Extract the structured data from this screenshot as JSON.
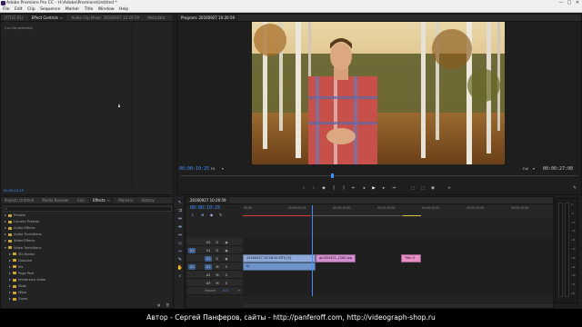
{
  "window": {
    "title": "Adobe Premiere Pro CC - H:\\Adobe\\Premiere\\Untitled *",
    "minimize": "—",
    "maximize": "□",
    "close": "✕"
  },
  "menu": [
    "File",
    "Edit",
    "Clip",
    "Sequence",
    "Marker",
    "Title",
    "Window",
    "Help"
  ],
  "source_panel": {
    "tabs": [
      "(TITLE 01)",
      "Effect Controls",
      "Audio Clip Mixer: 20160927 10:26:59",
      "Metadata"
    ],
    "message": "(no clip selected)",
    "bottom_tc": "00:00:10:25"
  },
  "program_monitor": {
    "tab": "Program: 20160927 10:26:59",
    "timecode_left": "00:00:10:25",
    "fit": "Fit",
    "quality": "Full",
    "timecode_right": "00:00:27:00"
  },
  "project_panel": {
    "tabs": [
      "Project: Untitled",
      "Media Browser",
      "Info",
      "Effects",
      "Markers",
      "History"
    ],
    "search_placeholder": "",
    "tree": [
      {
        "label": "Presets",
        "level": 0,
        "open": false,
        "folder": true
      },
      {
        "label": "Lumetri Presets",
        "level": 0,
        "open": false,
        "folder": true
      },
      {
        "label": "Audio Effects",
        "level": 0,
        "open": false,
        "folder": true
      },
      {
        "label": "Audio Transitions",
        "level": 0,
        "open": false,
        "folder": true
      },
      {
        "label": "Video Effects",
        "level": 0,
        "open": false,
        "folder": true
      },
      {
        "label": "Video Transitions",
        "level": 0,
        "open": true,
        "folder": true
      },
      {
        "label": "3D Motion",
        "level": 1,
        "open": false,
        "folder": true
      },
      {
        "label": "Dissolve",
        "level": 1,
        "open": false,
        "folder": true
      },
      {
        "label": "Iris",
        "level": 1,
        "open": false,
        "folder": true
      },
      {
        "label": "Page Peel",
        "level": 1,
        "open": false,
        "folder": true
      },
      {
        "label": "Immersive Video",
        "level": 1,
        "open": false,
        "folder": true
      },
      {
        "label": "Slide",
        "level": 1,
        "open": false,
        "folder": true
      },
      {
        "label": "Wipe",
        "level": 1,
        "open": false,
        "folder": true
      },
      {
        "label": "Zoom",
        "level": 1,
        "open": false,
        "folder": true
      }
    ]
  },
  "timeline": {
    "tab": "20160927 10:26:59",
    "timecode": "00:00:10:25",
    "ruler": [
      "00:00",
      "00:00:05:00",
      "00:00:10:00",
      "00:00:15:00",
      "00:00:20:00",
      "00:00:25:00",
      "00:00:30:00"
    ],
    "tracks": [
      {
        "name": "V3",
        "kind": "video"
      },
      {
        "name": "V2",
        "kind": "video"
      },
      {
        "name": "V1",
        "kind": "video"
      },
      {
        "name": "A1",
        "kind": "audio"
      },
      {
        "name": "A2",
        "kind": "audio"
      },
      {
        "name": "A3",
        "kind": "audio"
      }
    ],
    "master_label": "Master",
    "master_value": "0.0",
    "clips": [
      {
        "label": "20160927 10:26:59.MTS [V]",
        "track": "V1",
        "color": "#8fa9d8"
      },
      {
        "label": "gif-855421_1280.jpg",
        "track": "V1",
        "color": "#d68fd0"
      },
      {
        "label": "Title 0",
        "track": "V1",
        "color": "#e88fc8"
      },
      {
        "label": "fx",
        "track": "A1",
        "color": "#6e93c8"
      }
    ]
  },
  "meter_scale": [
    "0",
    "-6",
    "-12",
    "-18",
    "-24",
    "-30",
    "-36",
    "-42",
    "-48",
    "-54",
    "dB"
  ],
  "footer": "Автор - Сергей Панферов, сайты - http://panferoff.com, http://videograph-shop.ru"
}
